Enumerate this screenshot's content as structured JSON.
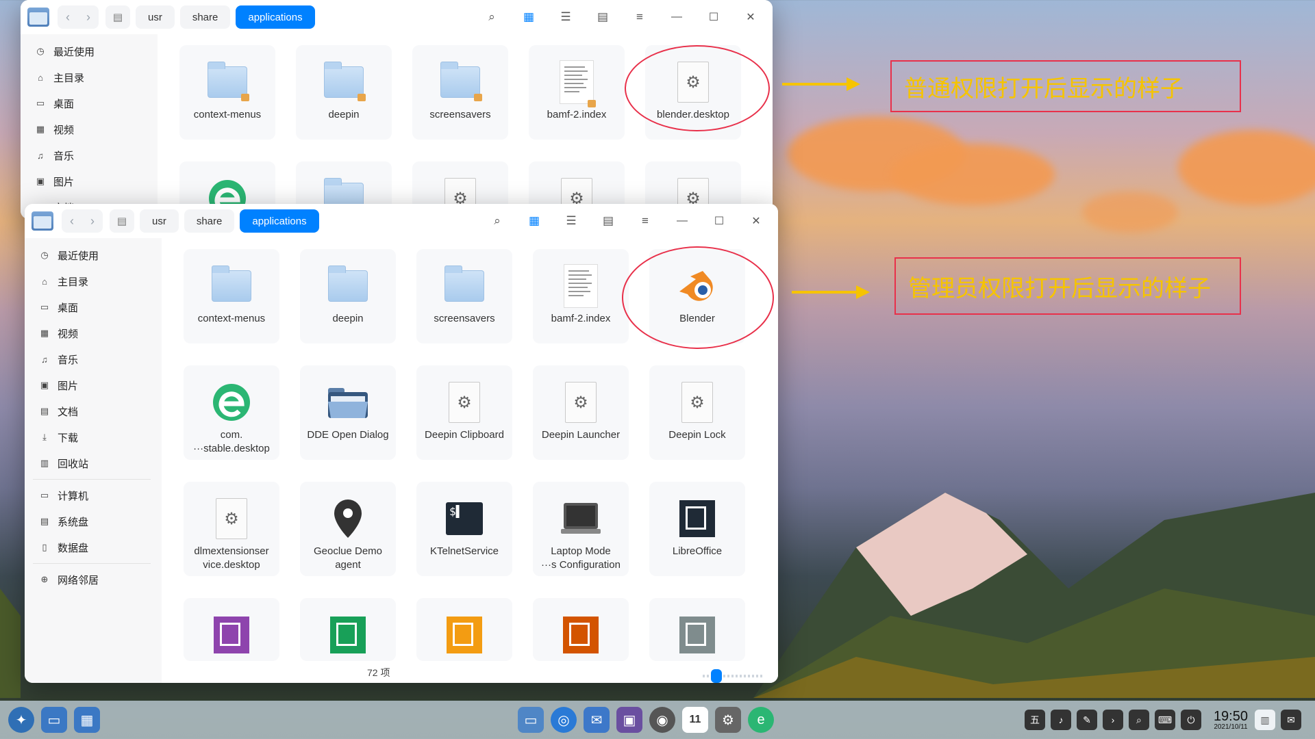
{
  "breadcrumb": {
    "path": [
      "usr",
      "share",
      "applications"
    ]
  },
  "sidebar": {
    "items": [
      {
        "icon": "clock-icon",
        "glyph": "◷",
        "label": "最近使用"
      },
      {
        "icon": "home-icon",
        "glyph": "⌂",
        "label": "主目录"
      },
      {
        "icon": "desktop-icon",
        "glyph": "▭",
        "label": "桌面"
      },
      {
        "icon": "video-icon",
        "glyph": "▦",
        "label": "视频"
      },
      {
        "icon": "music-icon",
        "glyph": "♫",
        "label": "音乐"
      },
      {
        "icon": "picture-icon",
        "glyph": "▣",
        "label": "图片"
      },
      {
        "icon": "document-icon",
        "glyph": "▤",
        "label": "文档"
      },
      {
        "icon": "download-icon",
        "glyph": "⤓",
        "label": "下载"
      },
      {
        "icon": "trash-icon",
        "glyph": "▥",
        "label": "回收站"
      }
    ],
    "devices": [
      {
        "icon": "computer-icon",
        "glyph": "▭",
        "label": "计算机"
      },
      {
        "icon": "system-disk-icon",
        "glyph": "▤",
        "label": "系统盘"
      },
      {
        "icon": "data-disk-icon",
        "glyph": "▯",
        "label": "数据盘"
      }
    ],
    "network": {
      "icon": "network-icon",
      "glyph": "⊕",
      "label": "网络邻居"
    }
  },
  "back_window": {
    "files": [
      {
        "label": "context-menus",
        "kind": "folder-locked"
      },
      {
        "label": "deepin",
        "kind": "folder-locked"
      },
      {
        "label": "screensavers",
        "kind": "folder-locked"
      },
      {
        "label": "bamf-2.index",
        "kind": "doc-locked"
      },
      {
        "label": "blender.desktop",
        "kind": "gear"
      }
    ]
  },
  "front_window": {
    "files": [
      {
        "label": "context-menus",
        "kind": "folder"
      },
      {
        "label": "deepin",
        "kind": "folder"
      },
      {
        "label": "screensavers",
        "kind": "folder"
      },
      {
        "label": "bamf-2.index",
        "kind": "doc"
      },
      {
        "label": "Blender",
        "kind": "blender"
      },
      {
        "label": "com.\n···stable.desktop",
        "kind": "edge"
      },
      {
        "label": "DDE Open Dialog",
        "kind": "dialog"
      },
      {
        "label": "Deepin Clipboard",
        "kind": "gear"
      },
      {
        "label": "Deepin Launcher",
        "kind": "gear"
      },
      {
        "label": "Deepin Lock",
        "kind": "gear"
      },
      {
        "label": "dlmextensionser\nvice.desktop",
        "kind": "gear"
      },
      {
        "label": "Geoclue Demo\nagent",
        "kind": "pin"
      },
      {
        "label": "KTelnetService",
        "kind": "terminal"
      },
      {
        "label": "Laptop Mode\n···s Configuration",
        "kind": "laptop"
      },
      {
        "label": "LibreOffice",
        "kind": "libre"
      },
      {
        "label": "",
        "kind": "libre-purple"
      },
      {
        "label": "",
        "kind": "libre-green"
      },
      {
        "label": "",
        "kind": "libre-orange"
      },
      {
        "label": "",
        "kind": "libre-red"
      },
      {
        "label": "",
        "kind": "libre-gray"
      }
    ],
    "status_count": "72 项"
  },
  "annotations": {
    "normal_note": "普通权限打开后显示的样子",
    "admin_note": "管理员权限打开后显示的样子",
    "accent": "#e8304a",
    "note_color": "#f6c400"
  },
  "taskbar": {
    "clock_time": "19:50",
    "clock_date": "2021/10/11",
    "calendar_day": "11"
  },
  "accent_color": "#0081ff"
}
